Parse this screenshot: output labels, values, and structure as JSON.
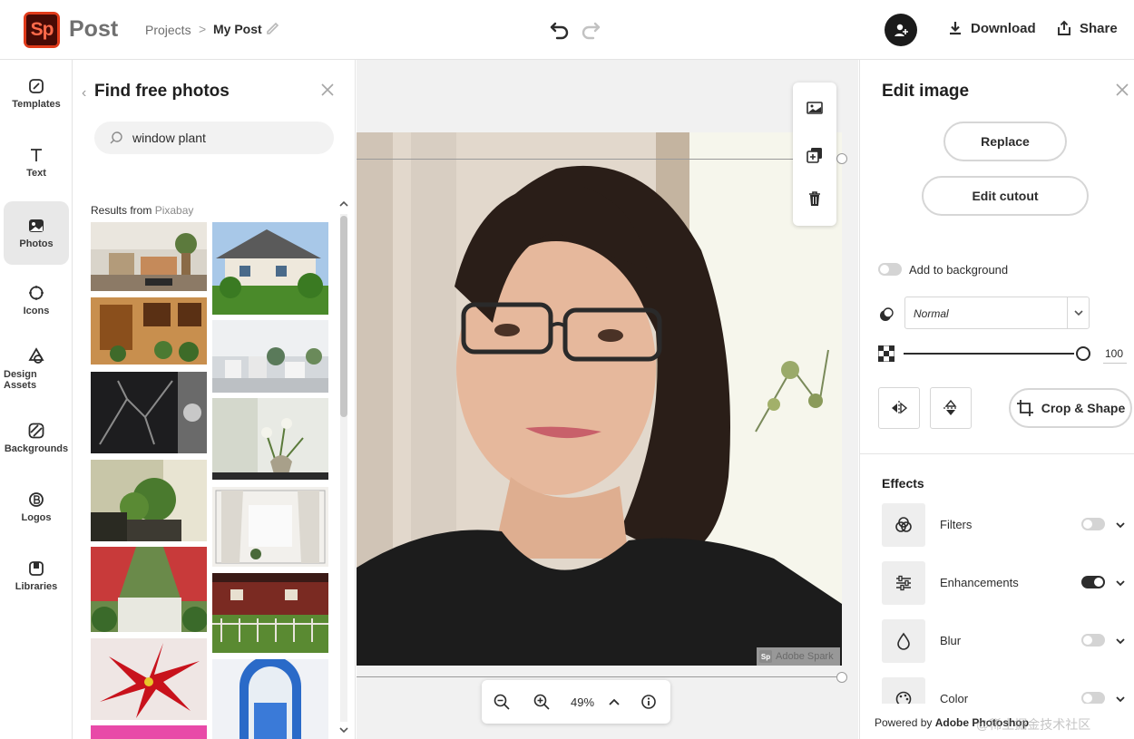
{
  "header": {
    "logo_text": "Sp",
    "app_name": "Post",
    "breadcrumb_projects": "Projects",
    "breadcrumb_separator": ">",
    "breadcrumb_current": "My Post",
    "download_label": "Download",
    "share_label": "Share"
  },
  "rail": {
    "items": [
      {
        "label": "Templates",
        "icon": "templates-icon"
      },
      {
        "label": "Text",
        "icon": "text-icon"
      },
      {
        "label": "Photos",
        "icon": "photos-icon",
        "active": true
      },
      {
        "label": "Icons",
        "icon": "icons-icon"
      },
      {
        "label": "Design Assets",
        "icon": "design-assets-icon"
      },
      {
        "label": "Backgrounds",
        "icon": "backgrounds-icon"
      },
      {
        "label": "Logos",
        "icon": "logos-icon"
      },
      {
        "label": "Libraries",
        "icon": "libraries-icon"
      }
    ]
  },
  "photos_panel": {
    "title": "Find free photos",
    "search_value": "window plant",
    "results_prefix": "Results from ",
    "results_source": "Pixabay"
  },
  "canvas": {
    "zoom": "49%",
    "watermark_logo": "Sp",
    "watermark_text": "Adobe Spark"
  },
  "edit_panel": {
    "title": "Edit image",
    "replace_label": "Replace",
    "edit_cutout_label": "Edit cutout",
    "add_to_background_label": "Add to background",
    "blend_mode": "Normal",
    "opacity_value": "100",
    "crop_shape_label": "Crop & Shape",
    "effects_title": "Effects",
    "effects": [
      {
        "label": "Filters",
        "enabled": false
      },
      {
        "label": "Enhancements",
        "enabled": true
      },
      {
        "label": "Blur",
        "enabled": false
      },
      {
        "label": "Color",
        "enabled": false
      }
    ],
    "footer_prefix": "Powered by ",
    "footer_brand": "Adobe Photoshop",
    "footer_watermark": "@稀土掘金技术社区"
  },
  "colors": {
    "brand_red": "#e03a1a",
    "brand_dark": "#470a05",
    "active_rail_bg": "#e8e8e8"
  }
}
